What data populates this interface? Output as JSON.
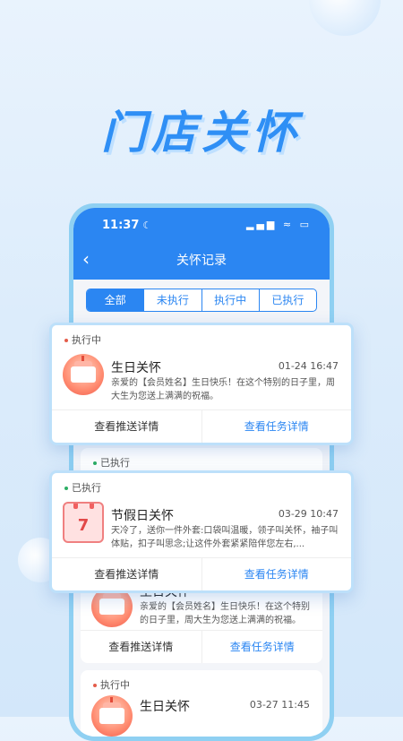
{
  "headline": "门店关怀",
  "phone": {
    "status": {
      "time": "11:37",
      "moon": "☾",
      "icons": "▂▄▆ ≈ ▭"
    },
    "nav": {
      "back_icon": "‹",
      "title": "关怀记录"
    },
    "tabs": [
      {
        "label": "全部",
        "active": true
      },
      {
        "label": "未执行",
        "active": false
      },
      {
        "label": "执行中",
        "active": false
      },
      {
        "label": "已执行",
        "active": false
      }
    ]
  },
  "float_card_1": {
    "status": "执行中",
    "title": "生日关怀",
    "date": "01-24 16:47",
    "body": "亲爱的【会员姓名】生日快乐！在这个特别的日子里，周大生为您送上满满的祝福。",
    "push_label": "查看推送详情",
    "task_label": "查看任务详情"
  },
  "behind_status": "已执行",
  "float_card_2": {
    "status": "已执行",
    "title": "节假日关怀",
    "date": "03-29 10:47",
    "calendar_num": "7",
    "body": "天冷了，送你一件外套:口袋叫温暖，领子叫关怀，袖子叫体贴，扣子叫思念;让这件外套紧紧陪伴您左右,...",
    "push_label": "查看推送详情",
    "task_label": "查看任务详情"
  },
  "card_3": {
    "title": "生日关怀",
    "body": "亲爱的【会员姓名】生日快乐！在这个特别的日子里，周大生为您送上满满的祝福。",
    "push_label": "查看推送详情",
    "task_label": "查看任务详情"
  },
  "card_4": {
    "status": "执行中",
    "title": "生日关怀",
    "date": "03-27 11:45"
  },
  "colors": {
    "primary": "#2b86f2",
    "dot_running": "#e45c4a",
    "dot_done": "#2cae64"
  }
}
